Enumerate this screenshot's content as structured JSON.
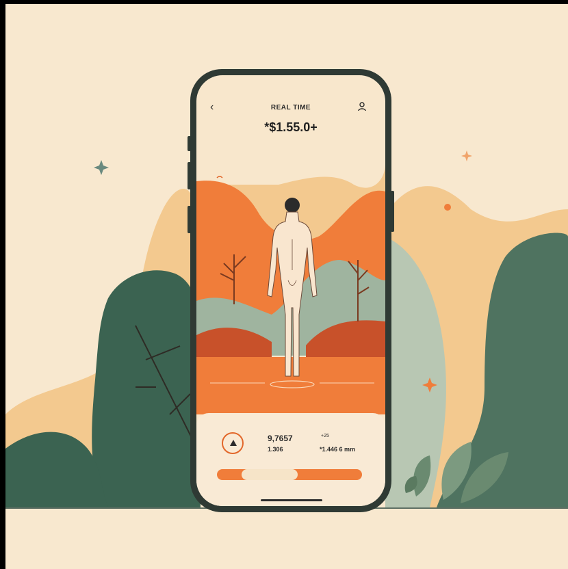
{
  "header": {
    "back_icon": "chevron-left-icon",
    "title": "REAL TIME",
    "user_icon": "user-icon"
  },
  "price": "*$1.55.0+",
  "stats": {
    "primary_value": "9,7657",
    "primary_sub": "1.306",
    "secondary_label": "+25",
    "secondary_value": "*1.446 6 mm"
  },
  "player": {
    "icon": "play-icon",
    "progress": 0.22
  },
  "colors": {
    "background": "#f8e8cf",
    "accent_orange": "#f07d3a",
    "dark_green": "#3b6351",
    "sage_green": "#9fb49f",
    "peach": "#f3c98f"
  }
}
